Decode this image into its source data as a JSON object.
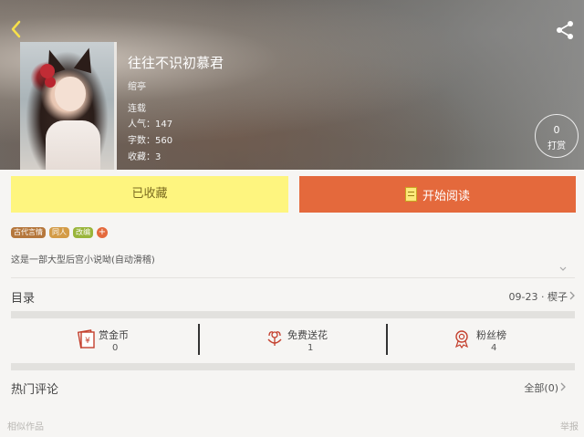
{
  "header": {
    "title": "往往不识初慕君",
    "author": "绾亭",
    "status": "连载",
    "popularity": "人气：147",
    "word_count": "字数：560",
    "favorites": "收藏：3",
    "tip": {
      "count": "0",
      "label": "打赏"
    },
    "back_icon": "chevron-left-icon",
    "share_icon": "share-icon"
  },
  "actions": {
    "collected_label": "已收藏",
    "read_label": "开始阅读"
  },
  "tags": [
    "古代言情",
    "同人",
    "改编"
  ],
  "tag_add": "+",
  "description": "这是一部大型后宫小说呦(自动滑稽)",
  "catalog": {
    "title": "目录",
    "latest": "09-23 · 楔子"
  },
  "perks": [
    {
      "label": "赏金币",
      "count": "0",
      "icon": "red-envelope-icon"
    },
    {
      "label": "免费送花",
      "count": "1",
      "icon": "flower-icon"
    },
    {
      "label": "粉丝榜",
      "count": "4",
      "icon": "medal-icon"
    }
  ],
  "comments": {
    "title": "热门评论",
    "all_label": "全部(0)"
  },
  "footer": {
    "similar": "相似作品",
    "report": "举报"
  },
  "colors": {
    "collected_bg": "#fef57f",
    "read_bg": "#e4693c",
    "icon_red": "#c4402e"
  }
}
